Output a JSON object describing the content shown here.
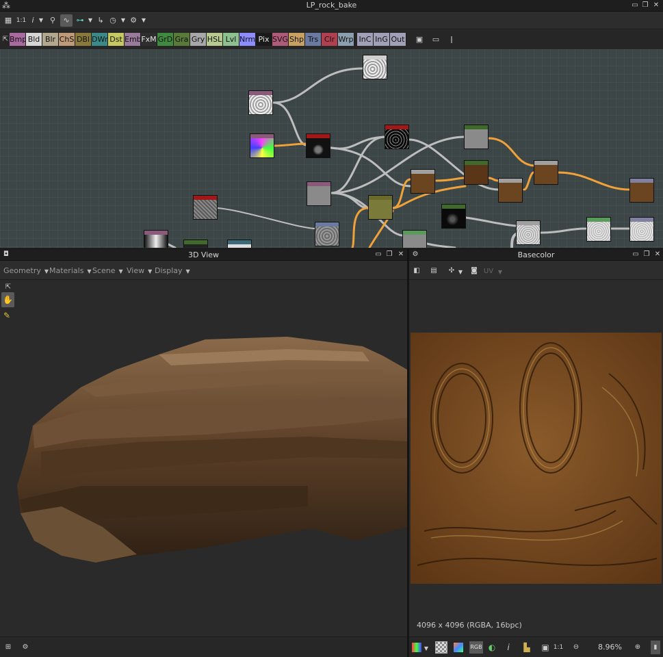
{
  "window": {
    "title": "LP_rock_bake"
  },
  "toolbar": {
    "ratio_label": "1:1",
    "info_label": "i"
  },
  "node_library": {
    "chips": [
      {
        "label": "Bmp",
        "color": "#a96aa0"
      },
      {
        "label": "Bld",
        "color": "#d6d6d6"
      },
      {
        "label": "Blr",
        "color": "#b3a88d"
      },
      {
        "label": "ChS",
        "color": "#bf9a78"
      },
      {
        "label": "DBl",
        "color": "#8a7a3a"
      },
      {
        "label": "DWr",
        "color": "#3a8a8a"
      },
      {
        "label": "Dst",
        "color": "#c8c860"
      },
      {
        "label": "Emb",
        "color": "#9a7a9a"
      },
      {
        "label": "FxM",
        "color": "#2e2e2e"
      },
      {
        "label": "GrD",
        "color": "#3f8a3f"
      },
      {
        "label": "Gra",
        "color": "#5a7a3a"
      },
      {
        "label": "Gry",
        "color": "#a8a8a8"
      },
      {
        "label": "HSL",
        "color": "#b7c98f"
      },
      {
        "label": "Lvl",
        "color": "#8fc08f"
      },
      {
        "label": "Nrm",
        "color": "#8d8dff"
      },
      {
        "label": "Pix",
        "color": "#1a1a1a"
      },
      {
        "label": "SVG",
        "color": "#b05a7a"
      },
      {
        "label": "Shp",
        "color": "#c8a060"
      },
      {
        "label": "Trs",
        "color": "#6a7aa0"
      },
      {
        "label": "Clr",
        "color": "#b04050"
      },
      {
        "label": "Wrp",
        "color": "#8aa0b0"
      },
      {
        "label": "InC",
        "color": "#a0a0b8"
      },
      {
        "label": "InG",
        "color": "#a0a0b8"
      },
      {
        "label": "Out",
        "color": "#a0a0b8"
      }
    ]
  },
  "view3d": {
    "title": "3D View",
    "menu": [
      "Geometry",
      "Materials",
      "Scene",
      "View",
      "Display"
    ]
  },
  "basecolor": {
    "title": "Basecolor",
    "uv_label": "UV",
    "info": "4096 x 4096 (RGBA, 16bpc)",
    "zoom": "8.96%",
    "ratio_label": "1:1",
    "rgb_label": "RGB"
  }
}
